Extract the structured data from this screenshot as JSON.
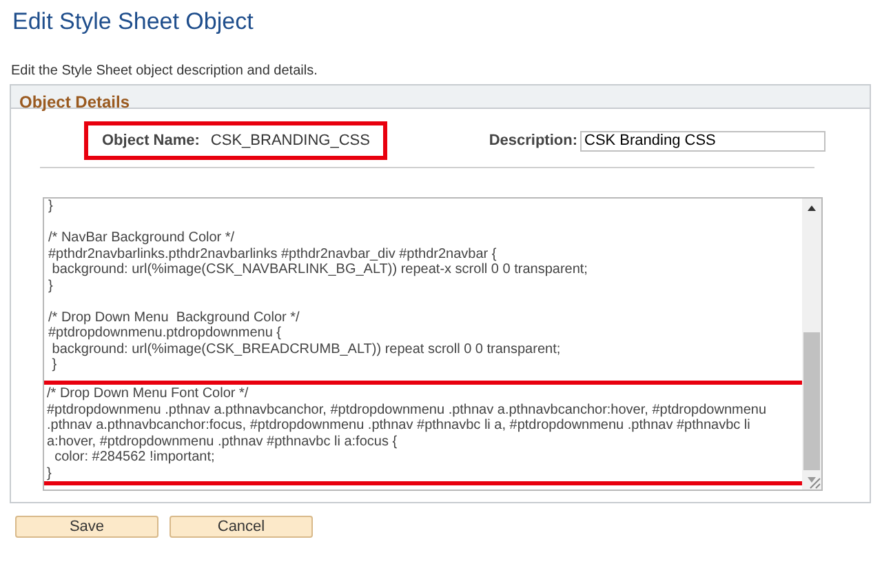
{
  "page": {
    "title": "Edit Style Sheet Object",
    "instructions": "Edit the Style Sheet object description and details."
  },
  "panel": {
    "title": "Object Details",
    "object_name": {
      "label": "Object Name:",
      "value": "CSK_BRANDING_CSS",
      "highlighted": true
    },
    "description": {
      "label": "Description:",
      "value": "CSK Branding CSS"
    },
    "code_blocks": [
      {
        "lines": [
          "}"
        ],
        "highlighted": false
      },
      {
        "lines": [
          "/* NavBar Background Color */",
          "#pthdr2navbarlinks.pthdr2navbarlinks #pthdr2navbar_div #pthdr2navbar {",
          " background: url(%image(CSK_NAVBARLINK_BG_ALT)) repeat-x scroll 0 0 transparent;",
          "}"
        ],
        "highlighted": false
      },
      {
        "lines": [
          "/* Drop Down Menu  Background Color */",
          "#ptdropdownmenu.ptdropdownmenu {",
          " background: url(%image(CSK_BREADCRUMB_ALT)) repeat scroll 0 0 transparent;",
          " }"
        ],
        "highlighted": false
      },
      {
        "lines": [
          "/* Drop Down Menu Font Color */",
          "#ptdropdownmenu .pthnav a.pthnavbcanchor, #ptdropdownmenu .pthnav a.pthnavbcanchor:hover, #ptdropdownmenu .pthnav a.pthnavbcanchor:focus, #ptdropdownmenu .pthnav #pthnavbc li a, #ptdropdownmenu .pthnav #pthnavbc li a:hover, #ptdropdownmenu .pthnav #pthnavbc li a:focus {",
          "  color: #284562 !important;",
          "}"
        ],
        "highlighted": true
      }
    ]
  },
  "buttons": [
    {
      "label": "Save"
    },
    {
      "label": "Cancel"
    }
  ]
}
